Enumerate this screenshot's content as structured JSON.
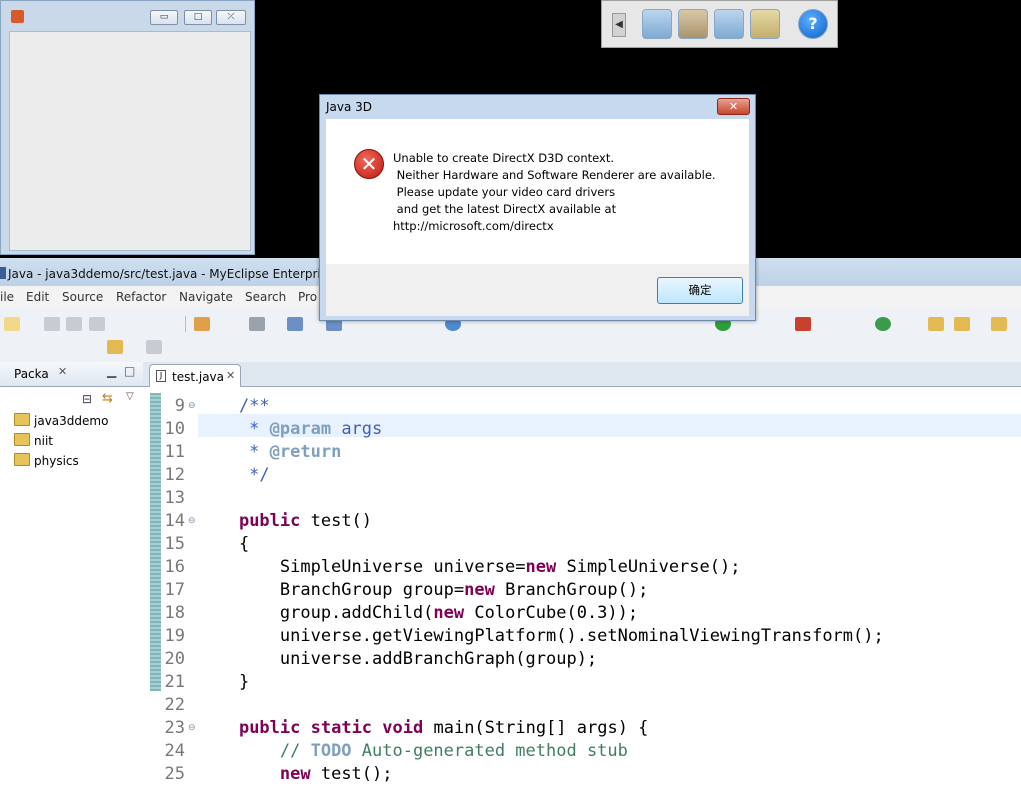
{
  "small_frame": {
    "min": "▭",
    "max": "□",
    "close": "⤫"
  },
  "eclipse": {
    "title": "Java - java3ddemo/src/test.java - MyEclipse Enterpris",
    "menu": [
      "ile",
      "Edit",
      "Source",
      "Refactor",
      "Navigate",
      "Search",
      "Pro"
    ],
    "package_explorer": {
      "tab_label": "Packa",
      "items": [
        "java3ddemo",
        "niit",
        "physics"
      ]
    },
    "editor": {
      "tab_label": "test.java",
      "lines": [
        {
          "n": "9",
          "code": "    /**"
        },
        {
          "n": "10",
          "code": "     * @param args"
        },
        {
          "n": "11",
          "code": "     * @return"
        },
        {
          "n": "12",
          "code": "     */"
        },
        {
          "n": "13",
          "code": ""
        },
        {
          "n": "14",
          "code": "    public test()"
        },
        {
          "n": "15",
          "code": "    {"
        },
        {
          "n": "16",
          "code": "        SimpleUniverse universe=new SimpleUniverse();"
        },
        {
          "n": "17",
          "code": "        BranchGroup group=new BranchGroup();"
        },
        {
          "n": "18",
          "code": "        group.addChild(new ColorCube(0.3));"
        },
        {
          "n": "19",
          "code": "        universe.getViewingPlatform().setNominalViewingTransform();"
        },
        {
          "n": "20",
          "code": "        universe.addBranchGraph(group);"
        },
        {
          "n": "21",
          "code": "    }"
        },
        {
          "n": "22",
          "code": ""
        },
        {
          "n": "23",
          "code": "    public static void main(String[] args) {"
        },
        {
          "n": "24",
          "code": "        // TODO Auto-generated method stub"
        },
        {
          "n": "25",
          "code": "        new test();"
        }
      ]
    }
  },
  "dialog": {
    "title": "Java 3D",
    "close": "✕",
    "icon": "error-icon",
    "message_lines": [
      "Unable to create DirectX D3D context.",
      " Neither Hardware and Software Renderer are available.",
      " Please update your video card drivers",
      " and get the latest DirectX available at",
      "http://microsoft.com/directx"
    ],
    "ok_label": "确定"
  }
}
